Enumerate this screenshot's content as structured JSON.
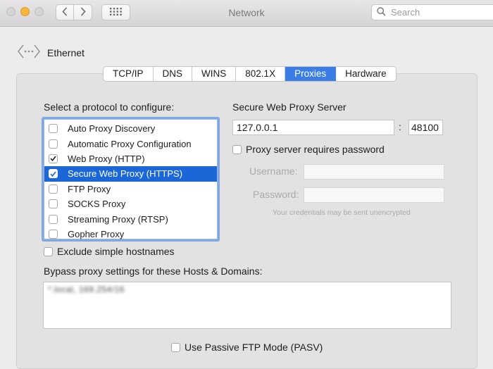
{
  "window": {
    "title": "Network"
  },
  "search": {
    "placeholder": "Search"
  },
  "breadcrumb": {
    "label": "Ethernet"
  },
  "tabs": [
    {
      "label": "TCP/IP",
      "active": false
    },
    {
      "label": "DNS",
      "active": false
    },
    {
      "label": "WINS",
      "active": false
    },
    {
      "label": "802.1X",
      "active": false
    },
    {
      "label": "Proxies",
      "active": true
    },
    {
      "label": "Hardware",
      "active": false
    }
  ],
  "protocols": {
    "heading": "Select a protocol to configure:",
    "items": [
      {
        "label": "Auto Proxy Discovery",
        "checked": false,
        "selected": false
      },
      {
        "label": "Automatic Proxy Configuration",
        "checked": false,
        "selected": false
      },
      {
        "label": "Web Proxy (HTTP)",
        "checked": true,
        "selected": false
      },
      {
        "label": "Secure Web Proxy (HTTPS)",
        "checked": true,
        "selected": true
      },
      {
        "label": "FTP Proxy",
        "checked": false,
        "selected": false
      },
      {
        "label": "SOCKS Proxy",
        "checked": false,
        "selected": false
      },
      {
        "label": "Streaming Proxy (RTSP)",
        "checked": false,
        "selected": false
      },
      {
        "label": "Gopher Proxy",
        "checked": false,
        "selected": false
      }
    ]
  },
  "server": {
    "heading": "Secure Web Proxy Server",
    "host": "127.0.0.1",
    "separator": ":",
    "port": "48100",
    "requires_password_label": "Proxy server requires password",
    "requires_password": false,
    "username_label": "Username:",
    "password_label": "Password:",
    "credentials_note": "Your credentials may be sent unencrypted"
  },
  "exclude_simple": {
    "label": "Exclude simple hostnames",
    "checked": false
  },
  "bypass": {
    "heading": "Bypass proxy settings for these Hosts & Domains:",
    "value": "*.local, 169.254/16"
  },
  "passive_ftp": {
    "label": "Use Passive FTP Mode (PASV)",
    "checked": false
  },
  "colors": {
    "accent": "#3a7de6",
    "selection": "#1c67d8",
    "focus_ring": "#7fa9e3",
    "minimize": "#f6b73e"
  }
}
